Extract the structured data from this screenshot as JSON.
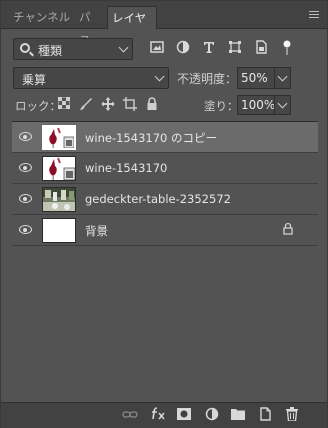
{
  "tabs": [
    {
      "label": "チャンネル",
      "active": false
    },
    {
      "label": "パス",
      "active": false
    },
    {
      "label": "レイヤー",
      "active": true
    }
  ],
  "filter": {
    "kind_label": "種類"
  },
  "blend": {
    "mode": "乗算"
  },
  "opacity": {
    "label": "不透明度：",
    "value": "50%"
  },
  "lock": {
    "label": "ロック："
  },
  "fill": {
    "label": "塗り：",
    "value": "100%"
  },
  "layers": [
    {
      "name": "wine-1543170 のコピー",
      "selected": true,
      "visible": true
    },
    {
      "name": "wine-1543170",
      "selected": false,
      "visible": true
    },
    {
      "name": "gedeckter-table-2352572",
      "selected": false,
      "visible": true
    },
    {
      "name": "背景",
      "selected": false,
      "visible": true,
      "locked": true
    }
  ],
  "colors": {
    "panel": "#535353",
    "selected_row": "#6b6b6b",
    "tabbar": "#424242"
  }
}
